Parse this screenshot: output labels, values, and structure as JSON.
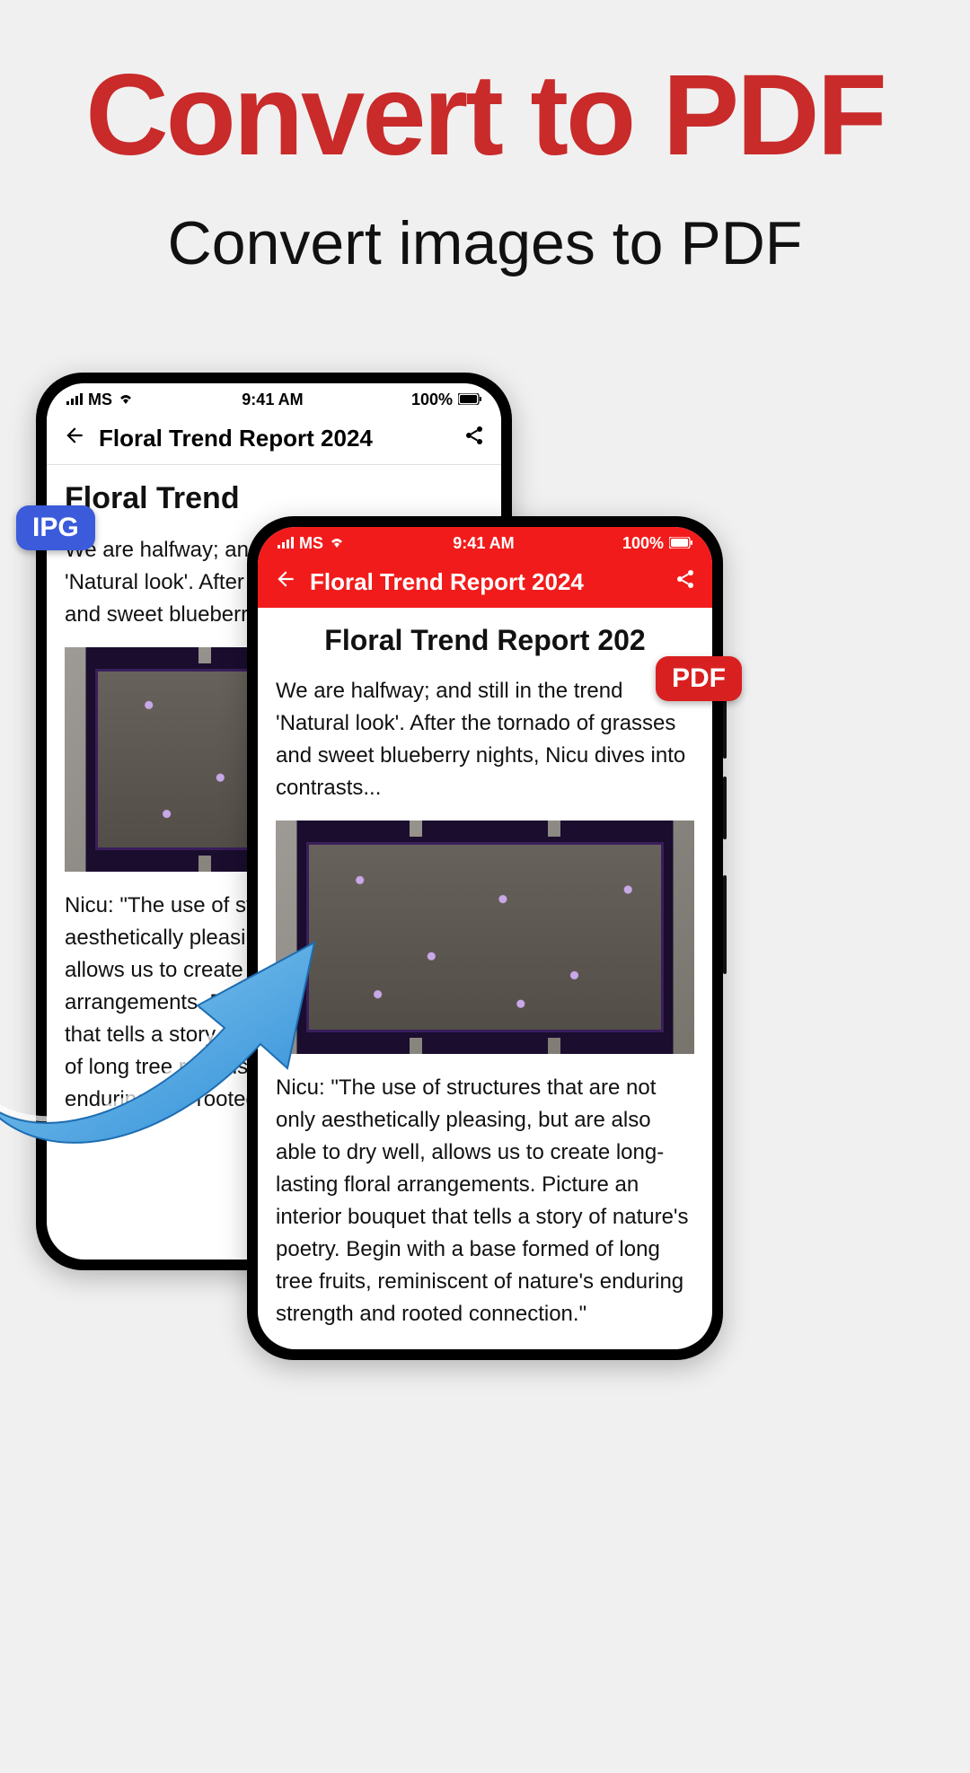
{
  "promo": {
    "headline": "Convert to PDF",
    "subheadline": "Convert images to PDF"
  },
  "badges": {
    "source": "IPG",
    "target": "PDF"
  },
  "phone_left": {
    "status": {
      "carrier": "MS",
      "time": "9:41 AM",
      "battery": "100%"
    },
    "header": {
      "title": "Floral Trend Report 2024"
    },
    "doc": {
      "title": "Floral Trend",
      "intro": "We are halfway; and still in the trend 'Natural look'. After the tornado of grasses and sweet blueberry nights, Nic",
      "body": "Nicu: \"The use of structures that are aesthetically pleasing, but are also dry well, allows us to create long-lasting floral arrangements. Picture an interior bouquet that tells a story. Begin with a base formed of long tree reminiscent of nature's enduring and rooted connection."
    }
  },
  "phone_right": {
    "status": {
      "carrier": "MS",
      "time": "9:41 AM",
      "battery": "100%"
    },
    "header": {
      "title": "Floral Trend Report 2024"
    },
    "doc": {
      "title": "Floral Trend Report 202",
      "intro": "We are halfway; and still in the trend 'Natural look'. After the tornado of grasses and sweet blueberry nights, Nicu dives into contrasts...",
      "body": "Nicu: \"The use of structures that are not only aesthetically pleasing, but are also able to dry well, allows us to create long-lasting floral arrangements. Picture an interior bouquet that tells a story of nature's poetry. Begin with a base formed of long tree fruits, reminiscent of nature's enduring strength and rooted connection.\""
    }
  }
}
